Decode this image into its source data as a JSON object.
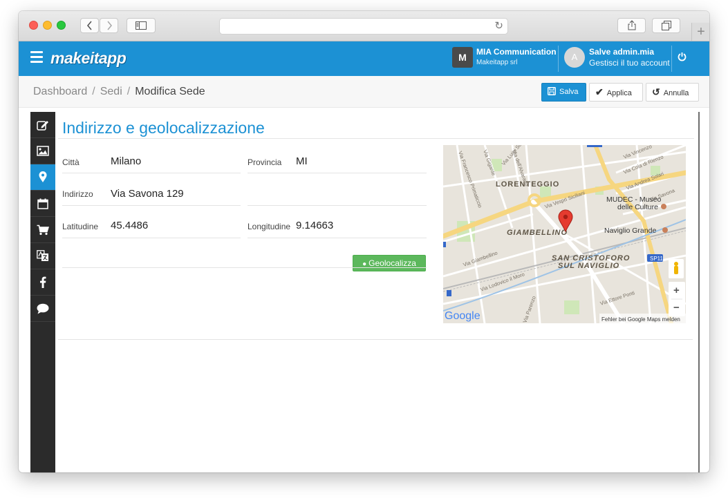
{
  "browser": {
    "back_icon": "chevron-left-icon",
    "forward_icon": "chevron-right-icon",
    "sidebar_icon": "sidebar-toggle-icon",
    "reload_icon": "reload-icon",
    "share_icon": "share-icon",
    "tabs_icon": "tabs-icon",
    "new_tab_icon": "plus-icon"
  },
  "app": {
    "brand": "makeitapp",
    "org_initial": "M",
    "org_name": "MIA Communication",
    "org_sub": "Makeitapp srl",
    "user_initial": "A",
    "user_name": "Salve admin.mia",
    "user_sub": "Gestisci il tuo account",
    "accent_color": "#1c91d4"
  },
  "breadcrumb": {
    "items": [
      "Dashboard",
      "Sedi",
      "Modifica Sede"
    ],
    "separator": "/"
  },
  "toolbar": {
    "save_label": "Salva",
    "apply_label": "Applica",
    "cancel_label": "Annulla"
  },
  "sidebar": {
    "items": [
      {
        "icon": "edit-icon"
      },
      {
        "icon": "image-icon"
      },
      {
        "icon": "map-marker-icon",
        "active": true
      },
      {
        "icon": "calendar-icon"
      },
      {
        "icon": "cart-icon"
      },
      {
        "icon": "translate-icon"
      },
      {
        "icon": "facebook-icon"
      },
      {
        "icon": "comment-icon"
      }
    ]
  },
  "section": {
    "title": "Indirizzo e geolocalizzazione"
  },
  "form": {
    "city_label": "Città",
    "city_value": "Milano",
    "province_label": "Provincia",
    "province_value": "MI",
    "address_label": "Indirizzo",
    "address_value": "Via Savona 129",
    "lat_label": "Latitudine",
    "lat_value": "45.4486",
    "lng_label": "Longitudine",
    "lng_value": "9.14663",
    "geolocate_label": "Geolocalizza"
  },
  "map": {
    "areas": [
      "LORENTEGGIO",
      "GIAMBELLINO",
      "SAN CRISTOFORO",
      "SUL NAVIGLIO"
    ],
    "streets": [
      "Via Francesco Primaticcio",
      "Via Gigante",
      "Via Luigi Soderini",
      "Via dell'Alvarado",
      "Via Vincenzo",
      "Via Cola di Rienzo",
      "Via Andrea Solari",
      "Via Savona",
      "Via Vespri Siciliani",
      "Via Giambellino",
      "Via Lodovico il Moro",
      "Via Parenzo",
      "Via Ettore Ponti"
    ],
    "pois": [
      "MUDEC - Museo",
      "delle Culture",
      "Naviglio Grande"
    ],
    "badge": "SP11",
    "google": "Google",
    "report": "Fehler bei Google Maps melden",
    "zoom_in": "+",
    "zoom_out": "−"
  }
}
